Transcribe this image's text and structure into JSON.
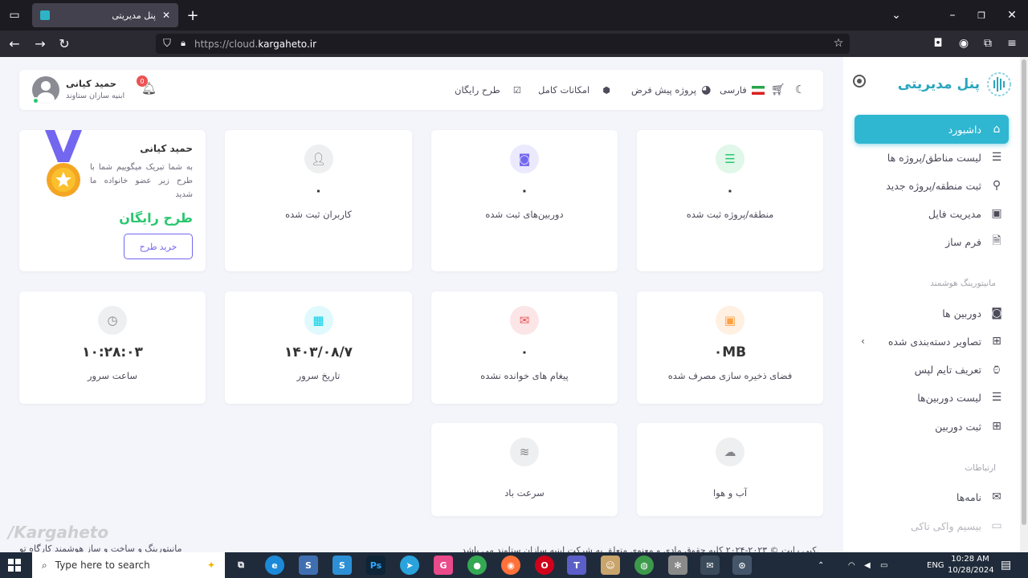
{
  "browser": {
    "tab_title": "پنل مدیریتی",
    "url_protocol": "https://cloud.",
    "url_host": "kargaheto.ir"
  },
  "sidebar": {
    "brand": "پنل مدیریتی",
    "items": [
      {
        "label": "داشبورد",
        "icon": "home-icon",
        "active": true
      },
      {
        "label": "لیست مناطق/پروژه ها",
        "icon": "list-icon"
      },
      {
        "label": "ثبت منطقه/پروژه جدید",
        "icon": "map-pin-icon"
      },
      {
        "label": "مدیریت فایل",
        "icon": "save-icon"
      },
      {
        "label": "فرم ساز",
        "icon": "file-text-icon"
      }
    ],
    "section_monitoring": "مانیتورینگ هوشمند",
    "monitoring_items": [
      {
        "label": "دوربین ها",
        "icon": "camera-icon"
      },
      {
        "label": "تصاویر دسته‌بندی شده",
        "icon": "grid-icon"
      },
      {
        "label": "تعریف تایم لپس",
        "icon": "watch-icon"
      },
      {
        "label": "لیست دوربین‌ها",
        "icon": "list-icon"
      },
      {
        "label": "ثبت دوربین",
        "icon": "plus-square-icon"
      }
    ],
    "section_comm": "ارتباطات",
    "comm_items": [
      {
        "label": "نامه‌ها",
        "icon": "mail-icon"
      },
      {
        "label": "بیسیم واکی تاکی",
        "icon": "cast-icon",
        "disabled": true
      }
    ]
  },
  "header": {
    "free_plan": "طرح رایگان",
    "full_features": "امکانات کامل",
    "default_project": "پروژه پیش فرض",
    "language": "فارسی",
    "user_name": "حمید کیانی",
    "user_org": "ابنیه سازان ستاوند",
    "notification_count": "0"
  },
  "stats": [
    {
      "value": "٠",
      "label": "منطقه/پروژه ثبت شده",
      "icon": "list-icon",
      "color": "#28c76f"
    },
    {
      "value": "٠",
      "label": "دوربین‌های ثبت شده",
      "icon": "camera-icon",
      "color": "#7367f0"
    },
    {
      "value": "٠",
      "label": "کاربران ثبت شده",
      "icon": "user-icon",
      "color": "#82868b"
    },
    {
      "value": "٠MB",
      "label": "فضای ذخیره سازی مصرف شده",
      "icon": "save-icon",
      "color": "#ff9f43"
    },
    {
      "value": "٠",
      "label": "پیغام های خوانده نشده",
      "icon": "mail-icon",
      "color": "#ea5455"
    },
    {
      "value": "١۴٠٣/٠٨/٧",
      "label": "تاریخ سرور",
      "icon": "calendar-icon",
      "color": "#00cfe8"
    },
    {
      "value": "١٠:٢٨:٠٣",
      "label": "ساعت سرور",
      "icon": "clock-icon",
      "color": "#82868b"
    },
    {
      "label": "آب و هوا",
      "icon": "cloud-icon",
      "color": "#82868b"
    },
    {
      "label": "سرعت باد",
      "icon": "wind-icon",
      "color": "#82868b"
    }
  ],
  "plan_card": {
    "name": "حمید کیانی",
    "message": "به شما تبریک میگوییم شما با طرح زیر عضو خانواده ما شدید",
    "plan": "طرح رایگان",
    "button": "خرید طرح"
  },
  "footer": {
    "left_text": "مانیتورینگ و ساخت و ساز هوشمند کارگاه تو",
    "copyright": "کپی رایت © ۲۰۲۳-۲۰۲۴ کلیه حقوق مادی و معنوی متعلق به شرکت ابنیه سازان ستاوند می باشد.",
    "watermark": "/Kargaheto"
  },
  "taskbar": {
    "search_placeholder": "Type here to search",
    "lang": "ENG",
    "time": "10:28 AM",
    "date": "10/28/2024"
  }
}
